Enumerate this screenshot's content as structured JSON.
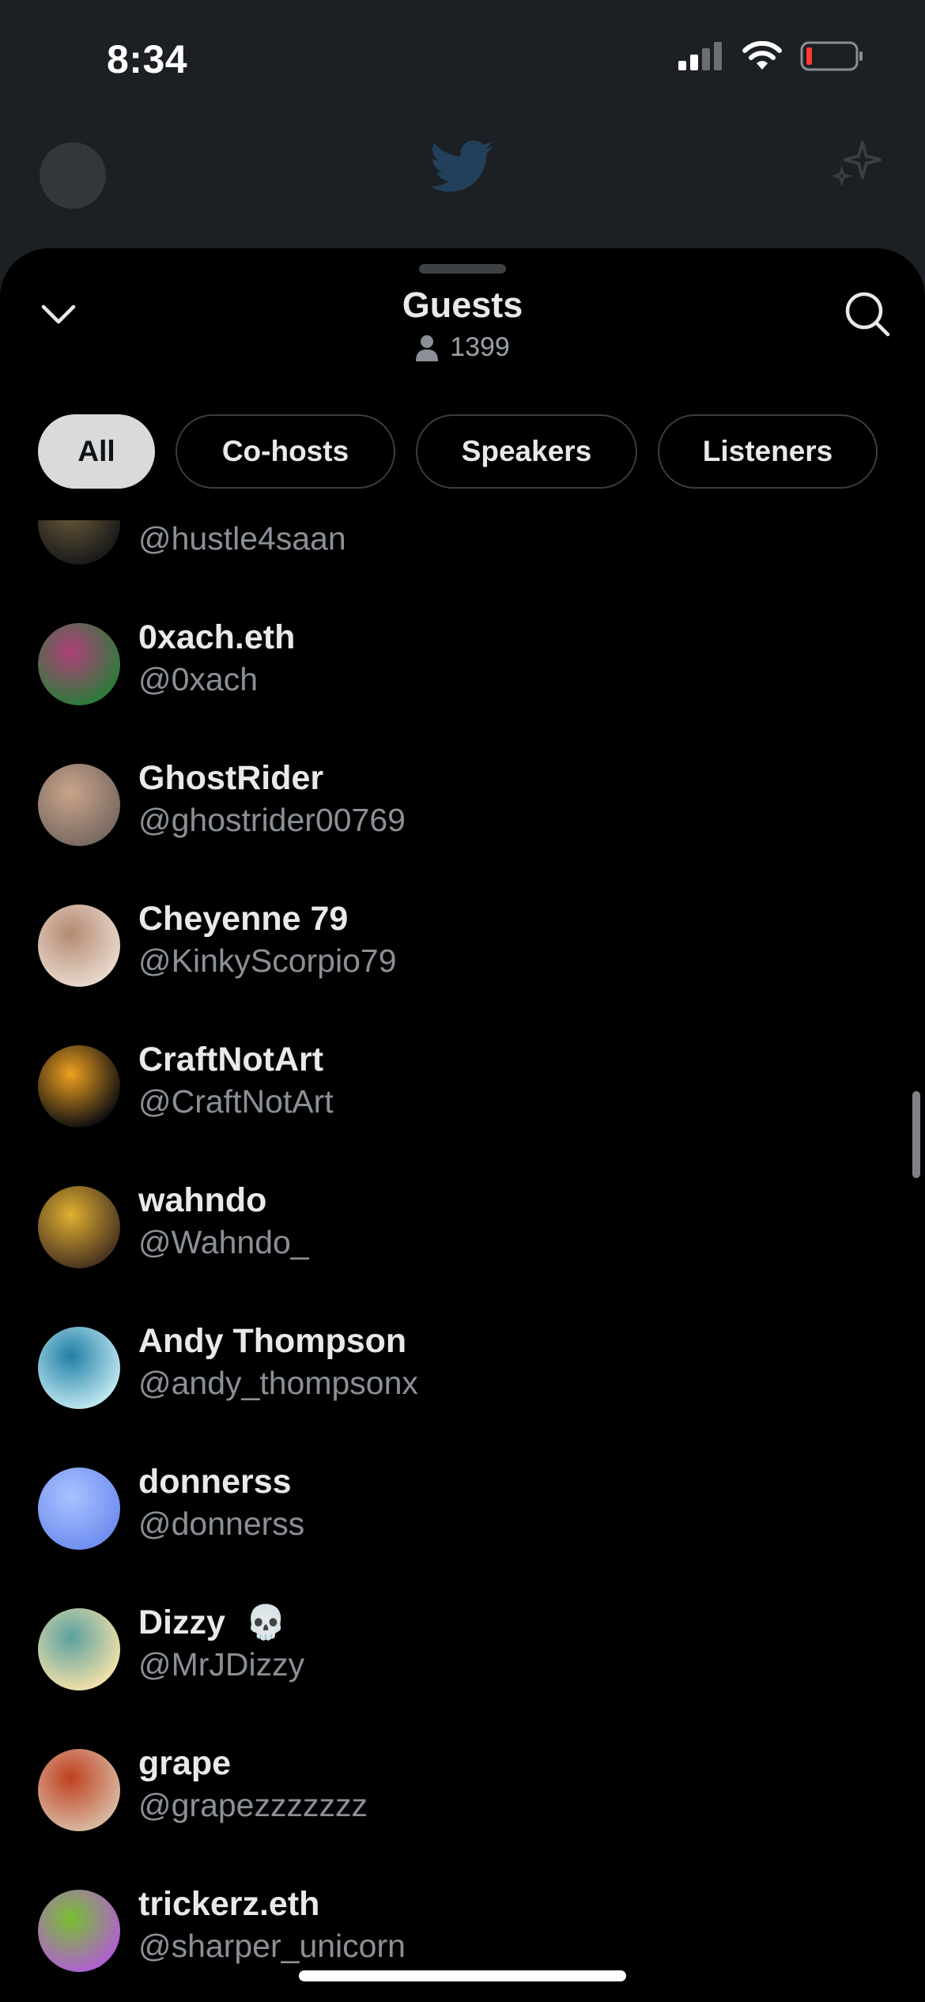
{
  "status": {
    "time": "8:34"
  },
  "header": {
    "title": "Guests",
    "count": "1399"
  },
  "filters": [
    {
      "label": "All",
      "active": true
    },
    {
      "label": "Co-hosts",
      "active": false
    },
    {
      "label": "Speakers",
      "active": false
    },
    {
      "label": "Listeners",
      "active": false
    }
  ],
  "guests": [
    {
      "name": "",
      "handle": "@hustle4saan",
      "avatar_colors": [
        "#1a1a1a",
        "#6b5a3a"
      ]
    },
    {
      "name": "0xach.eth",
      "handle": "@0xach",
      "avatar_colors": [
        "#2d7a3a",
        "#b0407a"
      ]
    },
    {
      "name": "GhostRider",
      "handle": "@ghostrider00769",
      "avatar_colors": [
        "#7a6a62",
        "#c9a48a"
      ]
    },
    {
      "name": "Cheyenne 79",
      "handle": "@KinkyScorpio79",
      "avatar_colors": [
        "#e8d8cc",
        "#b48a72"
      ]
    },
    {
      "name": "CraftNotArt",
      "handle": "@CraftNotArt",
      "avatar_colors": [
        "#111111",
        "#f0a020"
      ]
    },
    {
      "name": "wahndo",
      "handle": "@Wahndo_",
      "avatar_colors": [
        "#4a3420",
        "#e0b030"
      ]
    },
    {
      "name": "Andy Thompson",
      "handle": "@andy_thompsonx",
      "avatar_colors": [
        "#bfe6f0",
        "#1f7fa6"
      ]
    },
    {
      "name": "donnerss",
      "handle": "@donnerss",
      "avatar_colors": [
        "#6f8ef0",
        "#a9c3ff"
      ]
    },
    {
      "name": "Dizzy",
      "emoji": "💀",
      "handle": "@MrJDizzy",
      "avatar_colors": [
        "#f0e0a8",
        "#5aa0a0"
      ]
    },
    {
      "name": "grape",
      "handle": "@grapezzzzzzz",
      "avatar_colors": [
        "#d8b8a0",
        "#c04020"
      ]
    },
    {
      "name": "trickerz.eth",
      "handle": "@sharper_unicorn",
      "avatar_colors": [
        "#b060d0",
        "#78c030"
      ]
    }
  ]
}
